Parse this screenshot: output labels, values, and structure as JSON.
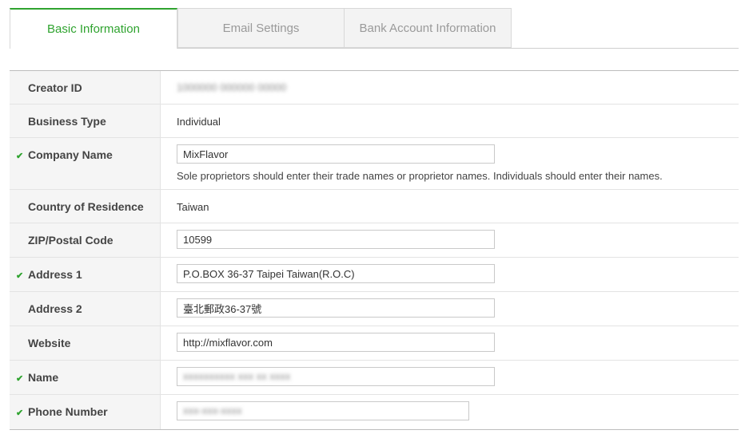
{
  "tabs": [
    {
      "label": "Basic Information",
      "active": true
    },
    {
      "label": "Email Settings",
      "active": false
    },
    {
      "label": "Bank Account Information",
      "active": false
    }
  ],
  "colors": {
    "accent": "#2fa32f",
    "label_bg": "#f5f5f5",
    "inactive_tab_bg": "#f3f3f3"
  },
  "form": {
    "creator_id": {
      "label": "Creator ID",
      "value": "1000000 000000 00000"
    },
    "business_type": {
      "label": "Business Type",
      "value": "Individual"
    },
    "company_name": {
      "label": "Company Name",
      "value": "MixFlavor",
      "help": "Sole proprietors should enter their trade names or proprietor names. Individuals should enter their names.",
      "checked": true
    },
    "country": {
      "label": "Country of Residence",
      "value": "Taiwan"
    },
    "zip": {
      "label": "ZIP/Postal Code",
      "value": "10599"
    },
    "address1": {
      "label": "Address 1",
      "value": "P.O.BOX 36-37 Taipei Taiwan(R.O.C)",
      "checked": true
    },
    "address2": {
      "label": "Address 2",
      "value": "臺北郵政36-37號"
    },
    "website": {
      "label": "Website",
      "value": "http://mixflavor.com"
    },
    "name": {
      "label": "Name",
      "value": "xxxxxxxxxx xxx xx xxxx",
      "checked": true
    },
    "phone": {
      "label": "Phone Number",
      "value": "xxx-xxx-xxxx",
      "checked": true
    }
  },
  "icons": {
    "check": "checkmark-icon"
  }
}
